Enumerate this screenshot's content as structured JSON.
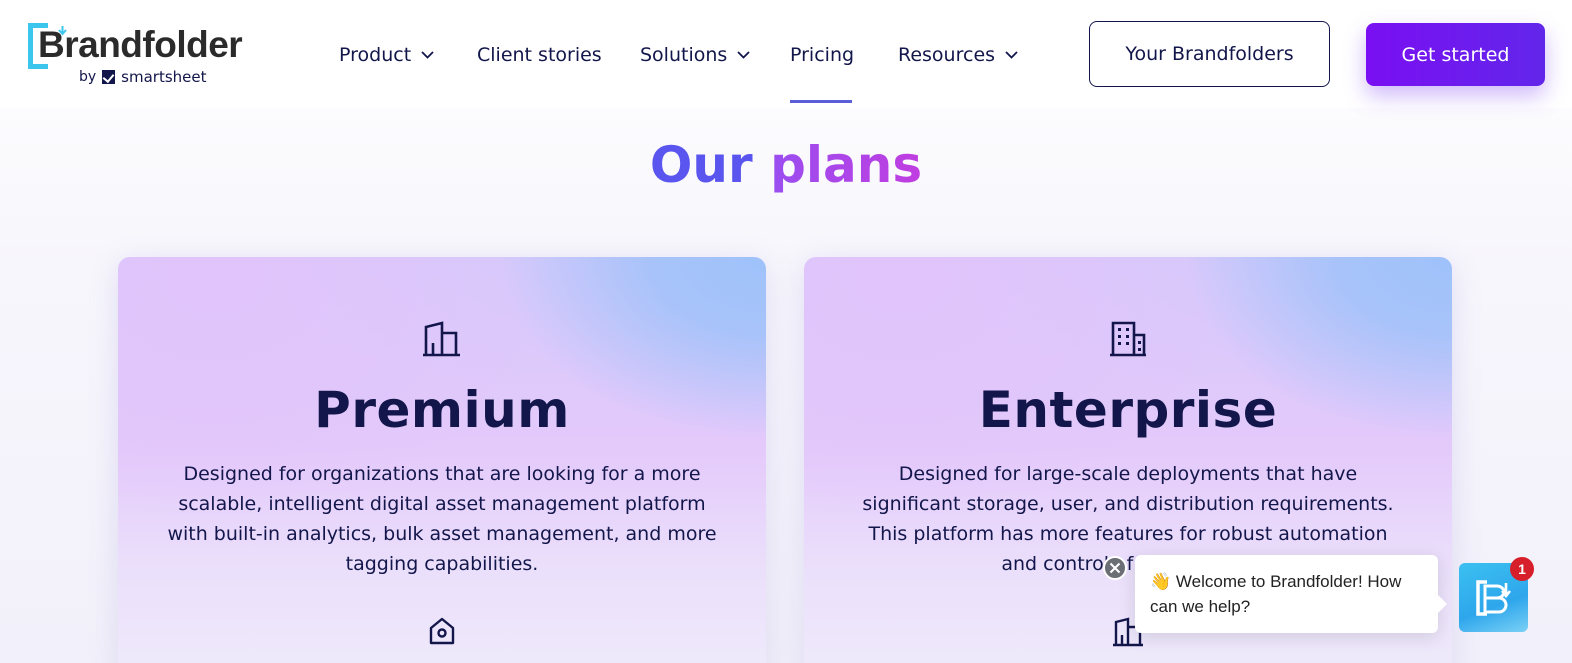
{
  "header": {
    "logo": {
      "name": "Brandfolder",
      "by": "by",
      "parent": "smartsheet"
    },
    "nav": [
      {
        "label": "Product",
        "has_dropdown": true
      },
      {
        "label": "Client stories",
        "has_dropdown": false
      },
      {
        "label": "Solutions",
        "has_dropdown": true
      },
      {
        "label": "Pricing",
        "has_dropdown": false,
        "active": true
      },
      {
        "label": "Resources",
        "has_dropdown": true
      }
    ],
    "your_brandfolders_label": "Your Brandfolders",
    "get_started_label": "Get started"
  },
  "main": {
    "heading_word1": "Our",
    "heading_word2": "plans",
    "plans": [
      {
        "name": "Premium",
        "icon": "building-icon",
        "description": "Designed for organizations that are looking for a more scalable, intelligent digital asset management platform with built-in analytics, bulk asset management, and more tagging capabilities.",
        "secondary_icon": "home-icon"
      },
      {
        "name": "Enterprise",
        "icon": "office-building-icon",
        "description": "Designed for large-scale deployments that have significant storage, user, and distribution requirements. This platform has more features for robust automation and control of your assets.",
        "secondary_icon": "building-icon"
      }
    ]
  },
  "chat": {
    "emoji": "👋",
    "message": "Welcome to Brandfolder! How can we help?",
    "badge_count": "1",
    "launcher_icon": "brandfolder-logo-icon"
  },
  "colors": {
    "navy": "#12164a",
    "primary_button": "#7a0ff3",
    "heading_blue": "#5a55ee",
    "heading_purple": "#b045e6",
    "logo_cyan": "#3cc6ee",
    "badge_red": "#d71f2b"
  }
}
